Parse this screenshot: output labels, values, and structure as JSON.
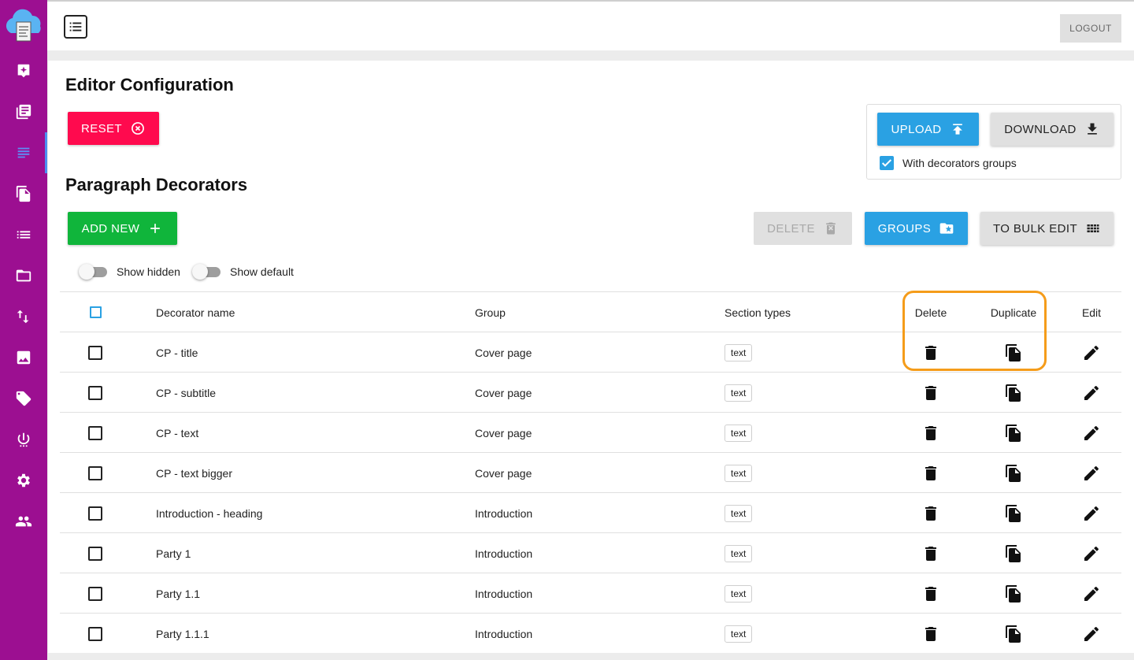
{
  "header": {
    "logout_label": "LOGOUT"
  },
  "page": {
    "title": "Editor Configuration",
    "reset_label": "RESET",
    "upload_label": "UPLOAD",
    "download_label": "DOWNLOAD",
    "with_groups_label": "With decorators groups",
    "with_groups_checked": true
  },
  "section": {
    "title": "Paragraph Decorators",
    "add_label": "ADD NEW",
    "delete_label": "DELETE",
    "groups_label": "GROUPS",
    "bulk_label": "TO BULK EDIT",
    "show_hidden_label": "Show hidden",
    "show_default_label": "Show default"
  },
  "table": {
    "columns": [
      "Decorator name",
      "Group",
      "Section types",
      "Delete",
      "Duplicate",
      "Edit"
    ],
    "rows": [
      {
        "name": "CP - title",
        "group": "Cover page",
        "type": "text"
      },
      {
        "name": "CP - subtitle",
        "group": "Cover page",
        "type": "text"
      },
      {
        "name": "CP - text",
        "group": "Cover page",
        "type": "text"
      },
      {
        "name": "CP - text bigger",
        "group": "Cover page",
        "type": "text"
      },
      {
        "name": "Introduction - heading",
        "group": "Introduction",
        "type": "text"
      },
      {
        "name": "Party 1",
        "group": "Introduction",
        "type": "text"
      },
      {
        "name": "Party 1.1",
        "group": "Introduction",
        "type": "text"
      },
      {
        "name": "Party 1.1.1",
        "group": "Introduction",
        "type": "text"
      }
    ]
  },
  "colors": {
    "sidebar": "#9c0f91",
    "reset": "#ff0a4e",
    "add": "#10b53b",
    "primary": "#2aa1e3",
    "highlight": "#f59c1a"
  },
  "icons": {
    "sidebar": [
      "cloud-doc-logo-icon",
      "spark-doc-icon",
      "library-icon",
      "paragraph-icon",
      "copy-doc-icon",
      "list-icon",
      "folder-icon",
      "sort-icon",
      "image-icon",
      "tag-icon",
      "power-icon",
      "gear-icon",
      "people-icon"
    ]
  }
}
